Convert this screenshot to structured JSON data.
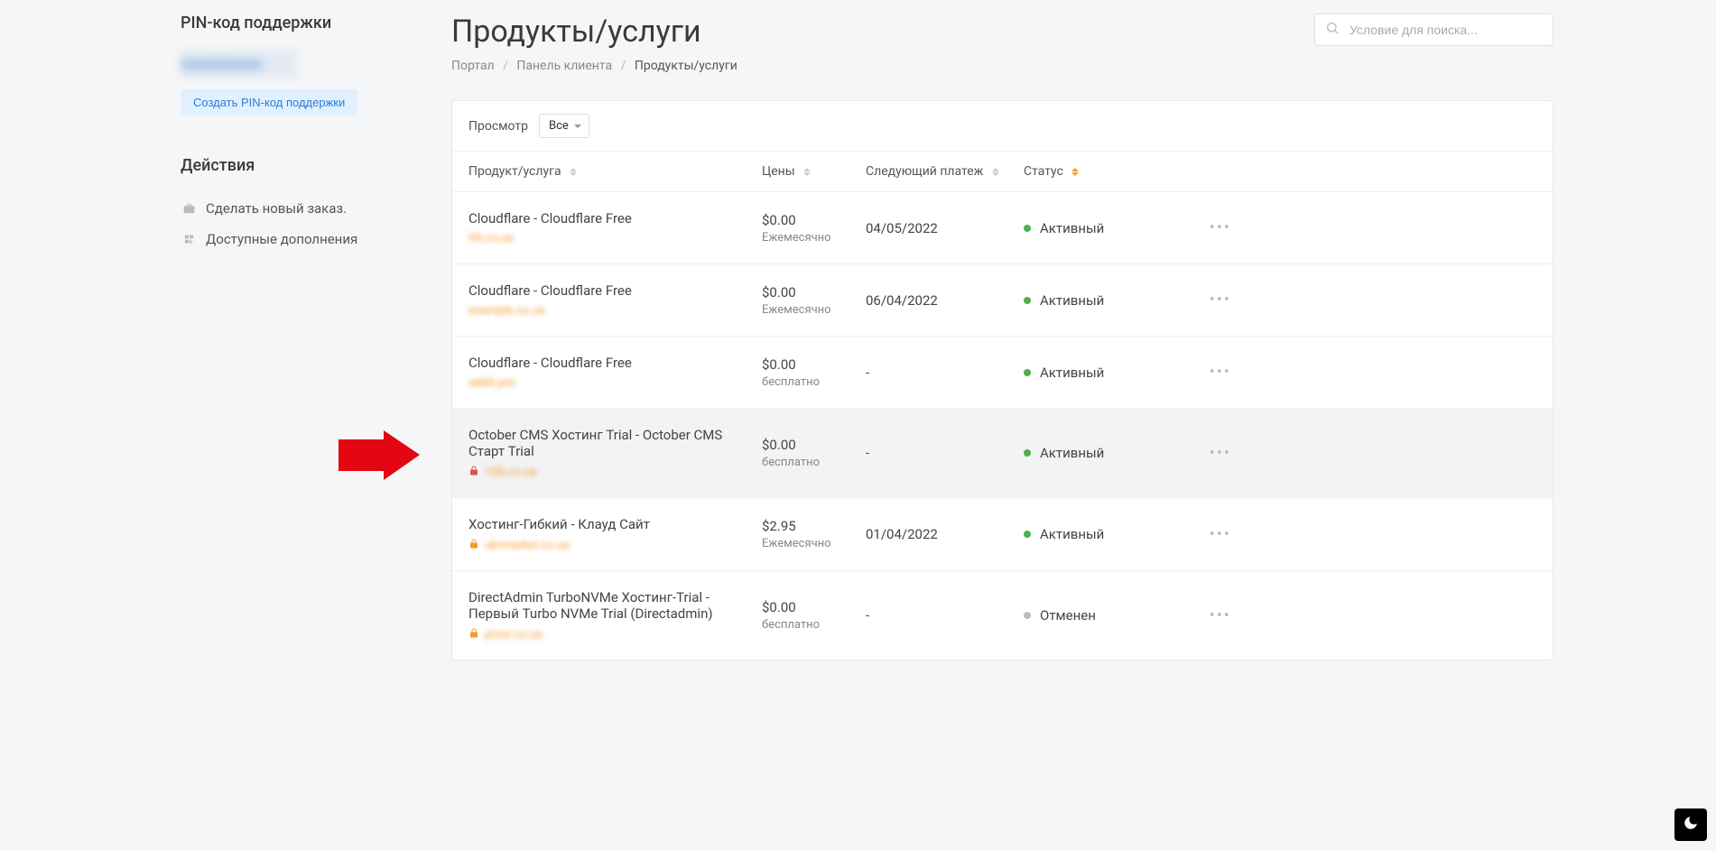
{
  "sidebar": {
    "pin_title": "PIN-код поддержки",
    "pin_placeholder": "XXXXXXXXX",
    "create_pin_button": "Создать PIN-код поддержки",
    "actions_title": "Действия",
    "actions": [
      {
        "label": "Сделать новый заказ.",
        "icon": "briefcase"
      },
      {
        "label": "Доступные дополнения",
        "icon": "addon"
      }
    ]
  },
  "header": {
    "title": "Продукты/услуги",
    "breadcrumb": {
      "portal": "Портал",
      "client": "Панель клиента",
      "current": "Продукты/услуги"
    },
    "search_placeholder": "Условие для поиска..."
  },
  "panel": {
    "view_label": "Просмотр",
    "filter_value": "Все",
    "columns": {
      "product": "Продукт/услуга",
      "price": "Цены",
      "next": "Следующий платеж",
      "status": "Статус"
    }
  },
  "products": [
    {
      "name": "Cloudflare - Cloudflare Free",
      "domain": "99.co.ua",
      "lock": "",
      "price": "$0.00",
      "cycle": "Ежемесячно",
      "next": "04/05/2022",
      "status": "Активный",
      "status_type": "active",
      "highlight": false
    },
    {
      "name": "Cloudflare - Cloudflare Free",
      "domain": "example.co.ua",
      "lock": "",
      "price": "$0.00",
      "cycle": "Ежемесячно",
      "next": "06/04/2022",
      "status": "Активный",
      "status_type": "active",
      "highlight": false
    },
    {
      "name": "Cloudflare - Cloudflare Free",
      "domain": "addit.pro",
      "lock": "",
      "price": "$0.00",
      "cycle": "бесплатно",
      "next": "-",
      "status": "Активный",
      "status_type": "active",
      "highlight": false
    },
    {
      "name": "October CMS Хостинг Trial - October CMS Старт Trial",
      "domain": "100.co.ua",
      "lock": "red",
      "price": "$0.00",
      "cycle": "бесплатно",
      "next": "-",
      "status": "Активный",
      "status_type": "active",
      "highlight": true
    },
    {
      "name": "Хостинг-Гибкий - Клауд Сайт",
      "domain": "ukrmarket.co.ua",
      "lock": "orange",
      "price": "$2.95",
      "cycle": "Ежемесячно",
      "next": "01/04/2022",
      "status": "Активный",
      "status_type": "active",
      "highlight": false
    },
    {
      "name": "DirectAdmin TurboNVMe Хостинг-Trial - Первый Turbo NVMe Trial (Directadmin)",
      "domain": "price.co.ua",
      "lock": "orange",
      "price": "$0.00",
      "cycle": "бесплатно",
      "next": "-",
      "status": "Отменен",
      "status_type": "cancelled",
      "highlight": false
    }
  ]
}
